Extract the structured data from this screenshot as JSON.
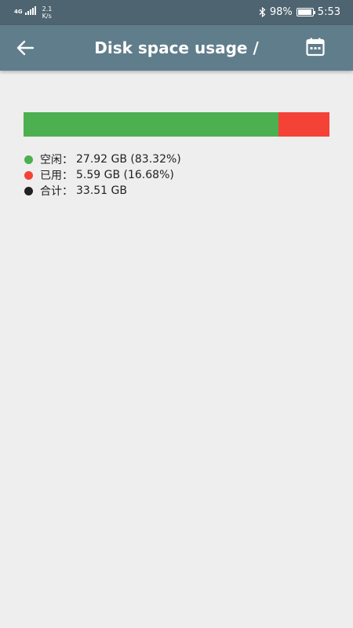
{
  "status_bar": {
    "network": "4G",
    "speed_value": "2.1",
    "speed_unit": "K/s",
    "battery": "98%",
    "time": "5:53"
  },
  "toolbar": {
    "title": "Disk space usage /",
    "back_icon": "arrow-left-icon",
    "calendar_icon": "calendar-icon"
  },
  "usage": {
    "free_fraction": 0.8332,
    "free_color": "#4caf50",
    "used_color": "#f44336",
    "total_color": "#212121"
  },
  "legend": {
    "free_label": "空闲：",
    "free_value": "27.92 GB (83.32%)",
    "used_label": "已用：",
    "used_value": "5.59 GB (16.68%)",
    "total_label": "合计：",
    "total_value": "33.51 GB"
  }
}
